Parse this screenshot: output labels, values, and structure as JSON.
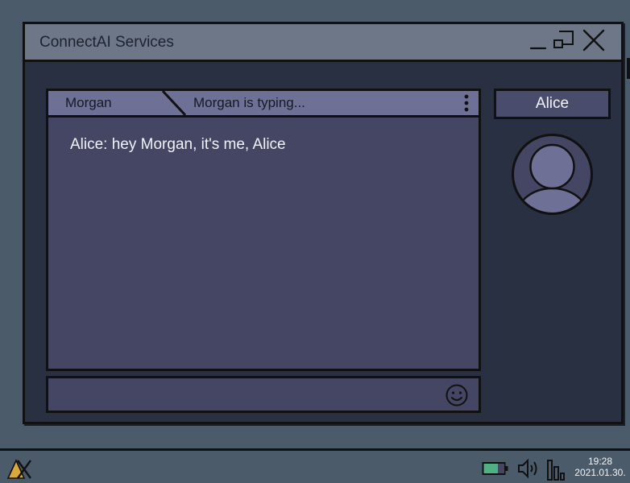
{
  "window": {
    "title": "ConnectAI Services"
  },
  "chat": {
    "tab_label": "Morgan",
    "status": "Morgan is typing...",
    "messages": [
      {
        "text": "Alice: hey Morgan, it's me, Alice"
      }
    ],
    "input": {
      "value": "",
      "placeholder": ""
    }
  },
  "contact": {
    "name": "Alice"
  },
  "taskbar": {
    "time": "19:28",
    "date": "2021.01.30."
  },
  "icons": {
    "minimize": "minimize-icon",
    "maximize": "maximize-icon",
    "close": "close-icon",
    "menu": "more-vertical-icon",
    "emoji": "smiley-icon",
    "avatar": "user-avatar-icon",
    "start": "start-logo-icon",
    "battery": "battery-icon",
    "volume": "volume-icon",
    "signal": "signal-icon"
  },
  "colors": {
    "desktop": "#4b5b6a",
    "window_bg": "#283042",
    "titlebar": "#6d7787",
    "chat_bg": "#444663",
    "tab_bg": "#6e7096",
    "battery_fill": "#4fb083",
    "start_accent": "#d9a93a"
  }
}
